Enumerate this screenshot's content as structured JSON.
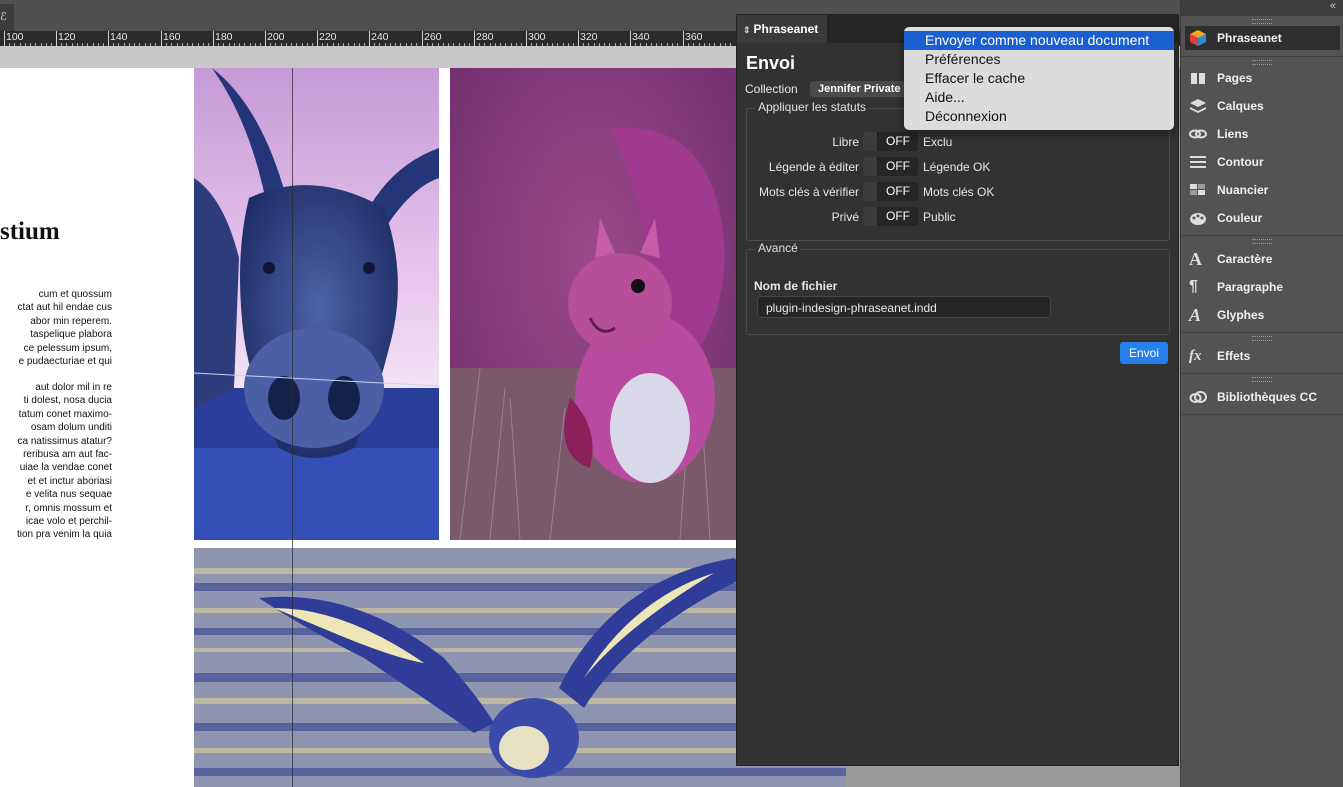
{
  "document": {
    "tab_glyph": "ℰ",
    "ruler_labels": [
      "100",
      "120",
      "140",
      "160",
      "180",
      "200",
      "220",
      "240",
      "260",
      "280",
      "300",
      "320",
      "340",
      "360"
    ],
    "heading": "stium",
    "paragraph_1": "cum et quossum\nctat aut hil endae cus\nabor min reperem.\ntaspelique plabora\nce pelessum ipsum,\ne pudaecturiae et qui",
    "paragraph_2": "aut dolor mil in re\nti dolest, nosa ducia\ntatum conet maximo-\nosam dolum unditi\nca natissimus atatur?\nreribusa am aut fac-\nuiae la vendae conet\net et inctur aboriasi\ne velita nus sequae\nr, omnis mossum et\nicae volo et perchil-\ntion pra venim la quia"
  },
  "panel": {
    "tab_label": "Phraseanet",
    "tab_icon": "updown-icon",
    "title": "Envoi",
    "collection_label": "Collection",
    "collection_value": "Jennifer Private",
    "statuses_legend": "Appliquer les statuts",
    "statuses": [
      {
        "left": "Libre",
        "state": "OFF",
        "right": "Exclu"
      },
      {
        "left": "Légende à éditer",
        "state": "OFF",
        "right": "Légende OK"
      },
      {
        "left": "Mots clés à vérifier",
        "state": "OFF",
        "right": "Mots clés OK"
      },
      {
        "left": "Privé",
        "state": "OFF",
        "right": "Public"
      }
    ],
    "advanced_legend": "Avancé",
    "filename_label": "Nom de fichier",
    "filename_value": "plugin-indesign-phraseanet.indd",
    "send_label": "Envoi"
  },
  "menu": {
    "items": [
      {
        "label": "Envoyer comme nouveau document",
        "active": true
      },
      {
        "label": "Préférences",
        "active": false
      },
      {
        "label": "Effacer le cache",
        "active": false
      },
      {
        "label": "Aide...",
        "active": false
      },
      {
        "label": "Déconnexion",
        "active": false
      }
    ]
  },
  "dock": {
    "collapse_glyph": "«",
    "items": [
      {
        "label": "Phraseanet",
        "icon": "phraseanet-cube-icon"
      },
      {
        "label": "Pages",
        "icon": "pages-icon"
      },
      {
        "label": "Calques",
        "icon": "layers-icon"
      },
      {
        "label": "Liens",
        "icon": "links-icon"
      },
      {
        "label": "Contour",
        "icon": "stroke-icon"
      },
      {
        "label": "Nuancier",
        "icon": "swatches-icon"
      },
      {
        "label": "Couleur",
        "icon": "color-palette-icon"
      },
      {
        "label": "Caractère",
        "icon": "character-icon"
      },
      {
        "label": "Paragraphe",
        "icon": "paragraph-icon"
      },
      {
        "label": "Glyphes",
        "icon": "glyphs-icon"
      },
      {
        "label": "Effets",
        "icon": "effects-fx-icon"
      },
      {
        "label": "Bibliothèques CC",
        "icon": "cc-libraries-icon"
      }
    ]
  },
  "colors": {
    "accent": "#2680eb",
    "menu_highlight": "#1a5fd0",
    "panel_bg": "#323232",
    "dock_bg": "#535353"
  }
}
